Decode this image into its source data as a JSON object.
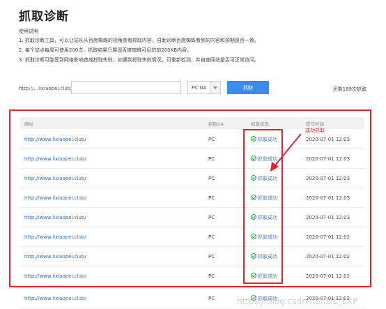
{
  "header": {
    "title": "抓取诊断",
    "usage_title": "使用说明"
  },
  "usage": [
    "1. 抓取诊断工具，可以让站长从百度蜘蛛的视角查看抓取内容，自助诊断百度蜘蛛看到的内容和预期是否一致。",
    "2. 每个站点每周可使用200次，抓取结果只展现百度蜘蛛可见的前200KB内容。",
    "3. 抓取诊断可能受到网络影响造成抓取失败，如遇到抓取失败情况，可重新检测，并自查网站是否可正常访问。"
  ],
  "form": {
    "url_prefix": "http://...lixiaopei.club/",
    "url_value": "",
    "ua_selected": "PC UA",
    "fetch_label": "抓取",
    "remaining": "还剩189次抓取"
  },
  "table": {
    "headers": [
      "网址",
      "抓取UA",
      "抓取状态",
      "提交时间"
    ],
    "rows": [
      {
        "url": "http://www.lixiaopei.club/",
        "ua": "PC",
        "status": "抓取成功",
        "time": "2020-07-01 12:03"
      },
      {
        "url": "http://www.lixiaopei.club/",
        "ua": "PC",
        "status": "抓取成功",
        "time": "2020-07-01 12:03"
      },
      {
        "url": "http://www.lixiaopei.club/",
        "ua": "PC",
        "status": "抓取成功",
        "time": "2020-07-01 12:03"
      },
      {
        "url": "http://www.lixiaopei.club/",
        "ua": "PC",
        "status": "抓取成功",
        "time": "2020-07-01 12:03"
      },
      {
        "url": "http://www.lixiaopei.club/",
        "ua": "PC",
        "status": "抓取成功",
        "time": "2020-07-01 12:03"
      },
      {
        "url": "http://www.lixiaopei.club/",
        "ua": "PC",
        "status": "抓取成功",
        "time": "2020-07-01 12:02"
      },
      {
        "url": "http://www.lixiaopei.club/",
        "ua": "PC",
        "status": "抓取成功",
        "time": "2020-07-01 12:02"
      },
      {
        "url": "http://www.lixiaopei.club/",
        "ua": "PC",
        "status": "抓取成功",
        "time": "2020-07-01 12:02"
      },
      {
        "url": "http://www.lixiaopei.club/",
        "ua": "PC",
        "status": "抓取成功",
        "time": "2020-07-01 12:02"
      }
    ]
  },
  "annotation": {
    "label": "成功抓取",
    "color": "#e8202a"
  },
  "watermark": "https://blog.csdn.net/DE_LXP",
  "colors": {
    "accent": "#3b8cf2",
    "link": "#2f6fd8",
    "success": "#2eae4d",
    "annotation": "#e8202a"
  },
  "icons": {
    "status": "check-circle-icon",
    "dropdown": "chevron-down-icon",
    "annotation": "arrow-icon"
  }
}
